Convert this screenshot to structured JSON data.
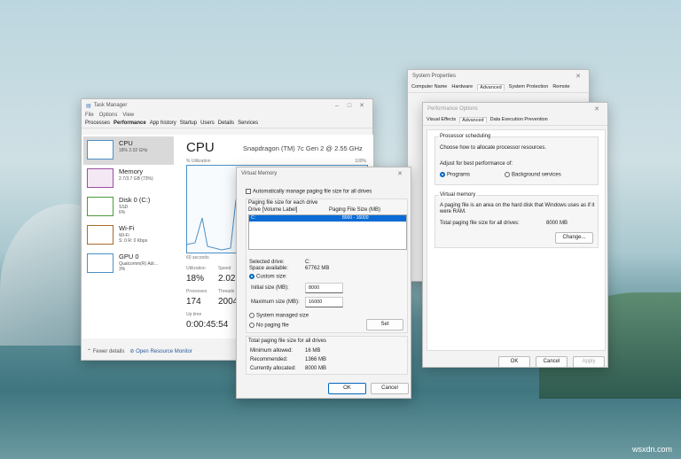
{
  "task_manager": {
    "title": "Task Manager",
    "menu": [
      "File",
      "Options",
      "View"
    ],
    "tabs": [
      "Processes",
      "Performance",
      "App history",
      "Startup",
      "Users",
      "Details",
      "Services"
    ],
    "active_tab": "Performance",
    "sidebar": [
      {
        "name": "CPU",
        "detail": "18% 2.02 GHz",
        "color": "#4a90c8"
      },
      {
        "name": "Memory",
        "detail": "2.7/3.7 GB (73%)",
        "color": "#9b4ea0"
      },
      {
        "name": "Disk 0 (C:)",
        "detail": "SSD\n6%",
        "color": "#4a9a3a"
      },
      {
        "name": "Wi-Fi",
        "detail": "Wi-Fi\nS: 0 R: 0 Kbps",
        "color": "#a86a2a"
      },
      {
        "name": "GPU 0",
        "detail": "Qualcomm(R) Adr...\n3%",
        "color": "#4a90c8"
      }
    ],
    "heading": "CPU",
    "processor": "Snapdragon (TM) 7c Gen 2 @ 2.55 GHz",
    "util_label": "% Utilization",
    "max_label": "100%",
    "time_label": "60 seconds",
    "stats": {
      "utilization_label": "Utilization",
      "utilization": "18%",
      "speed_label": "Speed",
      "speed": "2.02",
      "processes_label": "Processes",
      "processes": "174",
      "threads_label": "Threads",
      "threads": "2004",
      "uptime_label": "Up time",
      "uptime": "0:00:45:54"
    },
    "fewer_details": "Fewer details",
    "open_resource_monitor": "Open Resource Monitor"
  },
  "system_properties": {
    "title": "System Properties",
    "tabs": [
      "Computer Name",
      "Hardware",
      "Advanced",
      "System Protection",
      "Remote"
    ],
    "active_tab": "Advanced"
  },
  "performance_options": {
    "title": "Performance Options",
    "tabs": [
      "Visual Effects",
      "Advanced",
      "Data Execution Prevention"
    ],
    "active_tab": "Advanced",
    "proc_group": "Processor scheduling",
    "proc_desc": "Choose how to allocate processor resources.",
    "adjust": "Adjust for best performance of:",
    "programs": "Programs",
    "background": "Background services",
    "vm_group": "Virtual memory",
    "vm_desc": "A paging file is an area on the hard disk that Windows uses as if it were RAM.",
    "total_label": "Total paging file size for all drives:",
    "total_value": "8000 MB",
    "change": "Change...",
    "ok": "OK",
    "cancel": "Cancel",
    "apply": "Apply"
  },
  "virtual_memory": {
    "title": "Virtual Memory",
    "auto_manage": "Automatically manage paging file size for all drives",
    "auto_checked": false,
    "group": "Paging file size for each drive",
    "col_drive": "Drive [Volume Label]",
    "col_size": "Paging File Size (MB)",
    "rows": [
      {
        "drive": "C:",
        "size": "8000 - 16000"
      }
    ],
    "selected_drive_label": "Selected drive:",
    "selected_drive": "C:",
    "space_label": "Space available:",
    "space": "67762 MB",
    "custom": "Custom size:",
    "initial_label": "Initial size (MB):",
    "initial": "8000",
    "max_label": "Maximum size (MB):",
    "max": "16000",
    "system_managed": "System managed size",
    "no_paging": "No paging file",
    "set": "Set",
    "total_group": "Total paging file size for all drives",
    "min_label": "Minimum allowed:",
    "min": "16 MB",
    "rec_label": "Recommended:",
    "rec": "1366 MB",
    "cur_label": "Currently allocated:",
    "cur": "8000 MB",
    "ok": "OK",
    "cancel": "Cancel"
  },
  "watermark": "wsxdn.com"
}
